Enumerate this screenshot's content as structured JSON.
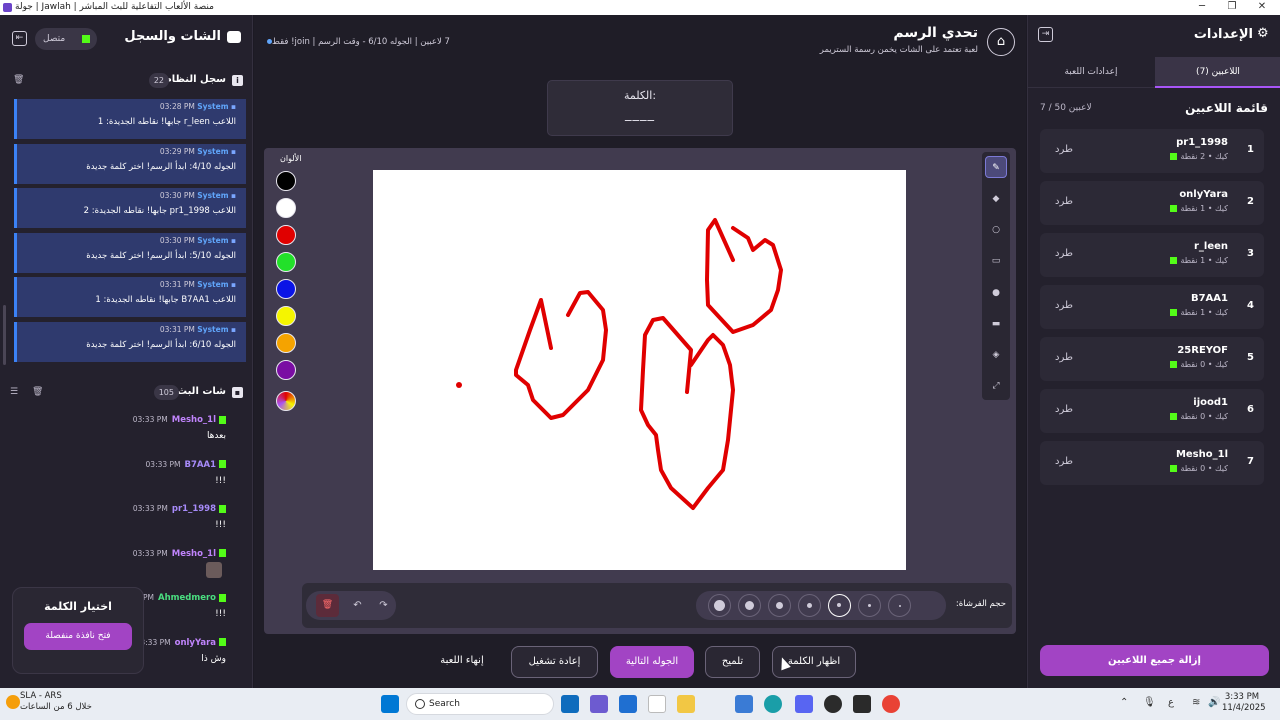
{
  "window": {
    "title": "منصة الألعاب التفاعلية للبث المباشر | Jawlah | جولة"
  },
  "right_panel": {
    "title": "الإعدادات",
    "tabs": [
      {
        "label": "اللاعبين (7)",
        "active": true
      },
      {
        "label": "إعدادات اللعبة",
        "active": false
      }
    ],
    "players_title": "قائمة اللاعبين",
    "players_count": "7 / 50 لاعبين",
    "players": [
      {
        "rank": "1",
        "name": "pr1_1998",
        "meta": "كيك • 2 نقطة",
        "kick_label": "طرد"
      },
      {
        "rank": "2",
        "name": "onlyYara",
        "meta": "كيك • 1 نقطة",
        "kick_label": "طرد"
      },
      {
        "rank": "3",
        "name": "r_leen",
        "meta": "كيك • 1 نقطة",
        "kick_label": "طرد"
      },
      {
        "rank": "4",
        "name": "B7AA1",
        "meta": "كيك • 1 نقطة",
        "kick_label": "طرد"
      },
      {
        "rank": "5",
        "name": "25REYOF",
        "meta": "كيك • 0 نقطة",
        "kick_label": "طرد"
      },
      {
        "rank": "6",
        "name": "ijood1",
        "meta": "كيك • 0 نقطة",
        "kick_label": "طرد"
      },
      {
        "rank": "7",
        "name": "Mesho_1l",
        "meta": "كيك • 0 نقطة",
        "kick_label": "طرد"
      }
    ],
    "remove_all": "إزالة جميع اللاعبين"
  },
  "left_panel": {
    "title": "الشات والسجل",
    "status": "متصل",
    "system_log": {
      "title": "سجل النظام",
      "count": "22",
      "messages": [
        {
          "who": "System",
          "time": "03:28 PM",
          "text": "اللاعب r_leen جابها! نقاطه الجديدة: 1"
        },
        {
          "who": "System",
          "time": "03:29 PM",
          "text": "الجوله 4/10: ابدأ الرسم! اختر كلمة جديدة"
        },
        {
          "who": "System",
          "time": "03:30 PM",
          "text": "اللاعب pr1_1998 جابها! نقاطه الجديدة: 2"
        },
        {
          "who": "System",
          "time": "03:30 PM",
          "text": "الجوله 5/10: ابدأ الرسم! اختر كلمة جديدة"
        },
        {
          "who": "System",
          "time": "03:31 PM",
          "text": "اللاعب B7AA1 جابها! نقاطه الجديدة: 1"
        },
        {
          "who": "System",
          "time": "03:31 PM",
          "text": "الجوله 6/10: ابدأ الرسم! اختر كلمة جديدة"
        }
      ]
    },
    "chat": {
      "title": "شات البث",
      "count": "105",
      "messages": [
        {
          "user": "Mesho_1l",
          "time": "03:33 PM",
          "text": "بعدها",
          "color": "#c084fc"
        },
        {
          "user": "B7AA1",
          "time": "03:33 PM",
          "text": "!!!",
          "color": "#a78bfa"
        },
        {
          "user": "pr1_1998",
          "time": "03:33 PM",
          "text": "!!!",
          "color": "#a78bfa"
        },
        {
          "user": "Mesho_1l",
          "time": "03:33 PM",
          "text": "",
          "color": "#c084fc"
        },
        {
          "user": "Ahmedmero",
          "time": "03:33 PM",
          "text": "!!!",
          "color": "#4ade80"
        },
        {
          "user": "onlyYara",
          "time": "03:33 PM",
          "text": "وش ذا",
          "color": "#c084fc"
        }
      ]
    },
    "word_choice": {
      "title": "اختيار الكلمة",
      "button": "فتح نافذة منفصلة"
    }
  },
  "center": {
    "title": "تحدي الرسم",
    "subtitle": "لعبة تعتمد على الشات يخمن رسمة الستريمر",
    "info": "7 لاعبين | الجوله 6/10 - وقت الرسم | join! فقط",
    "word_label": "الكلمة:",
    "word_value": "____",
    "palette_label": "الألوان",
    "colors": [
      "#000000",
      "#ffffff",
      "#e00000",
      "#22e02a",
      "#0a14e6",
      "#f5f500",
      "#f5a300",
      "#7a0ea3"
    ],
    "brush_label": "حجم الفرشاة:",
    "actions": {
      "reveal": "اظهار الكلمة",
      "hint": "تلميح",
      "next": "الجوله التالية",
      "restart": "إعادة تشغيل",
      "end": "إنهاء اللعبة"
    }
  },
  "taskbar": {
    "weather_title": "SLA - ARS",
    "weather_sub": "خلال 6 من الساعات",
    "search": "Search",
    "time": "3:33 PM",
    "date": "11/4/2025",
    "lang": "ع"
  }
}
